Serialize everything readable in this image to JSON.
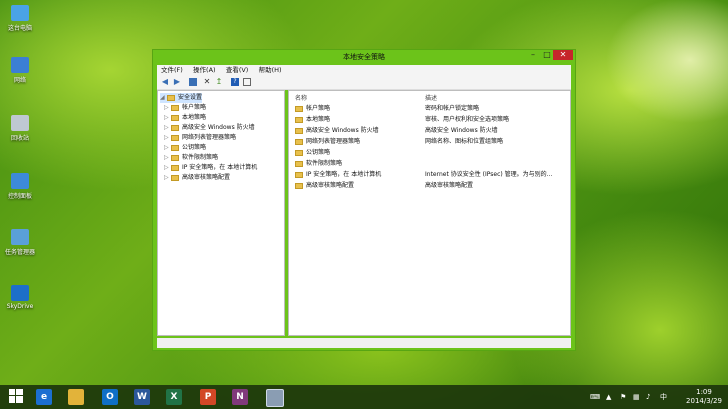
{
  "desktop": {
    "icons": [
      {
        "label": "这台电脑",
        "icon": "computer-icon"
      },
      {
        "label": "网络",
        "icon": "network-icon"
      },
      {
        "label": "回收站",
        "icon": "recycle-bin-icon"
      },
      {
        "label": "控制面板",
        "icon": "control-panel-icon"
      },
      {
        "label": "任务管理器",
        "icon": "task-manager-icon"
      },
      {
        "label": "SkyDrive",
        "icon": "skydrive-icon"
      }
    ]
  },
  "window": {
    "title": "本地安全策略",
    "menus": [
      "文件(F)",
      "操作(A)",
      "查看(V)",
      "帮助(H)"
    ],
    "tree": [
      {
        "label": "安全设置",
        "expanded": true,
        "selected": true
      },
      {
        "label": "帐户策略",
        "expanded": false
      },
      {
        "label": "本地策略",
        "expanded": false
      },
      {
        "label": "高级安全 Windows 防火墙",
        "expanded": false
      },
      {
        "label": "网络列表管理器策略",
        "expanded": false
      },
      {
        "label": "公钥策略",
        "expanded": false
      },
      {
        "label": "软件限制策略",
        "expanded": false
      },
      {
        "label": "IP 安全策略，在 本地计算机",
        "expanded": false
      },
      {
        "label": "高级审核策略配置",
        "expanded": false
      }
    ],
    "columns": {
      "name": "名称",
      "desc": "描述"
    },
    "rows": [
      {
        "name": "帐户策略",
        "desc": "密码和帐户锁定策略"
      },
      {
        "name": "本地策略",
        "desc": "审核、用户权利和安全选项策略"
      },
      {
        "name": "高级安全 Windows 防火墙",
        "desc": "高级安全 Windows 防火墙"
      },
      {
        "name": "网络列表管理器策略",
        "desc": "网络名称、图标和位置组策略"
      },
      {
        "name": "公钥策略",
        "desc": ""
      },
      {
        "name": "软件限制策略",
        "desc": ""
      },
      {
        "name": "IP 安全策略，在 本地计算机",
        "desc": "Internet 协议安全性 (IPsec) 管理。为与别的..."
      },
      {
        "name": "高级审核策略配置",
        "desc": "高级审核策略配置"
      }
    ]
  },
  "taskbar": {
    "apps": [
      {
        "name": "windows-start-button",
        "label": ""
      },
      {
        "name": "ie-app",
        "label": "e"
      },
      {
        "name": "explorer-app",
        "label": ""
      },
      {
        "name": "outlook-app",
        "label": "O"
      },
      {
        "name": "word-app",
        "label": "W"
      },
      {
        "name": "excel-app",
        "label": "X"
      },
      {
        "name": "powerpoint-app",
        "label": "P"
      },
      {
        "name": "onenote-app",
        "label": "N"
      },
      {
        "name": "local-security-policy-app",
        "label": ""
      }
    ],
    "time": "1:09",
    "date": "2014/3/29"
  },
  "colors": {
    "window_border": "#6cc31a",
    "taskbar": "#1c360c"
  }
}
